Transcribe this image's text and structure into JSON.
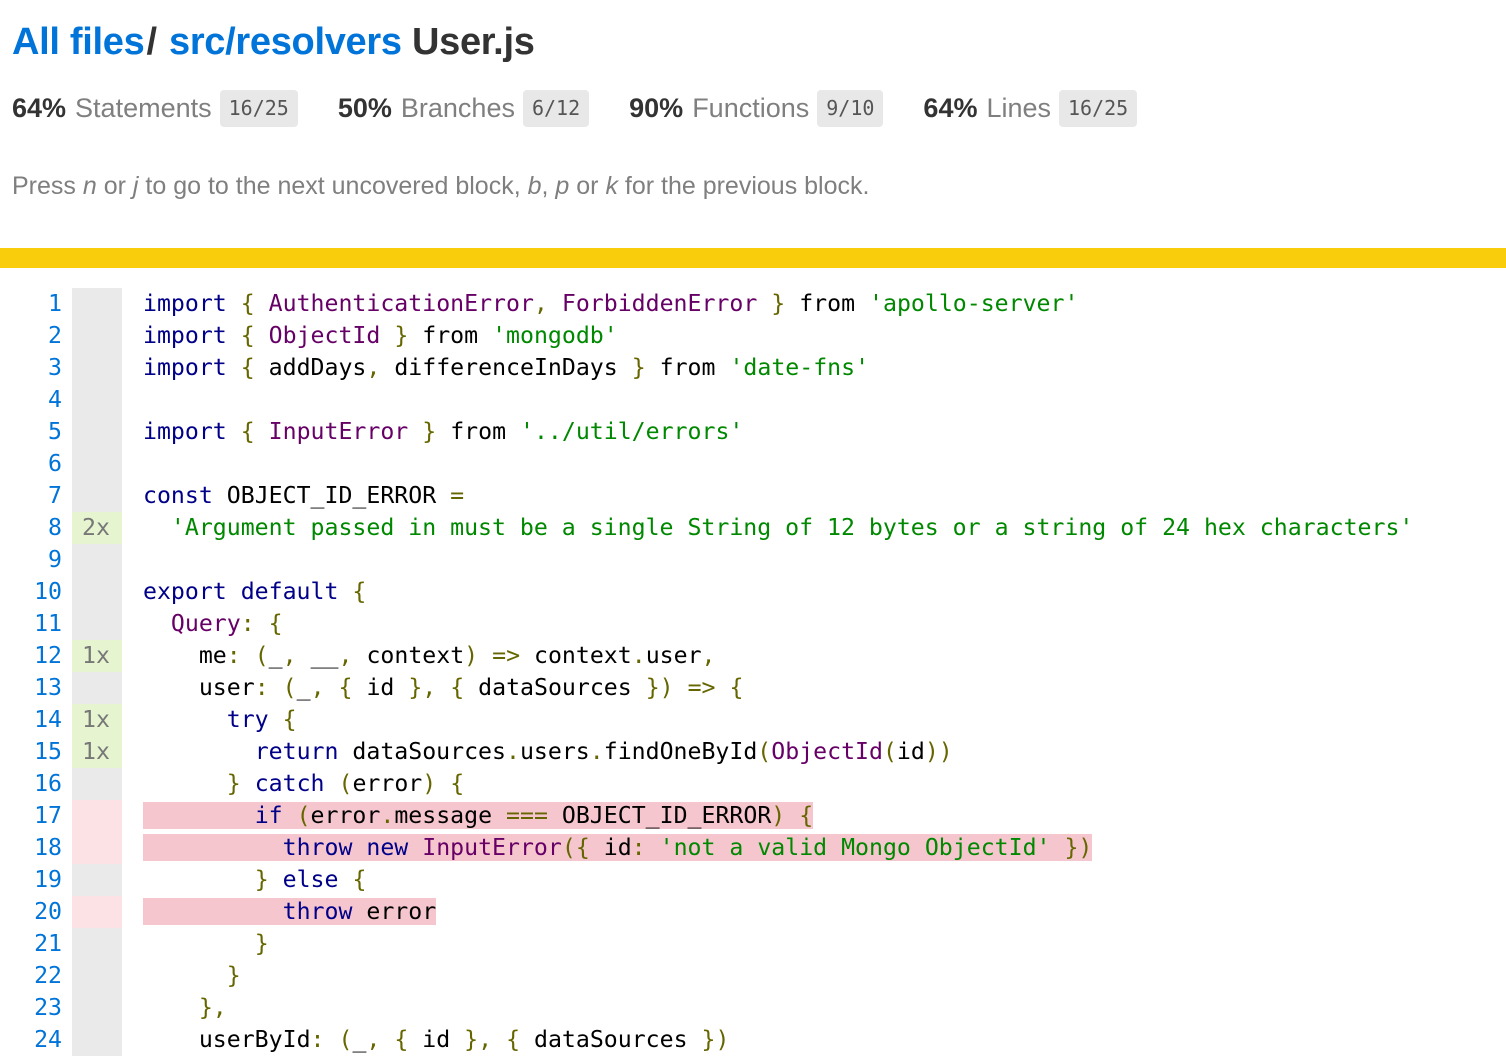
{
  "breadcrumb": {
    "all_files": "All files",
    "separator": "/",
    "folder": "src/resolvers",
    "file": "User.js"
  },
  "stats": [
    {
      "pct": "64%",
      "label": "Statements",
      "fraction": "16/25"
    },
    {
      "pct": "50%",
      "label": "Branches",
      "fraction": "6/12"
    },
    {
      "pct": "90%",
      "label": "Functions",
      "fraction": "9/10"
    },
    {
      "pct": "64%",
      "label": "Lines",
      "fraction": "16/25"
    }
  ],
  "hint": {
    "t1": "Press ",
    "k1": "n",
    "t2": " or ",
    "k2": "j",
    "t3": " to go to the next uncovered block, ",
    "k3": "b",
    "t4": ", ",
    "k4": "p",
    "t5": " or ",
    "k5": "k",
    "t6": " for the previous block."
  },
  "colors": {
    "status_bar": "#f9cd0b",
    "link": "#0074D9",
    "hit": "#e6f5d0",
    "miss": "#f6c6ce"
  },
  "lines": [
    {
      "n": "1",
      "count": "",
      "state": "neutral"
    },
    {
      "n": "2",
      "count": "",
      "state": "neutral"
    },
    {
      "n": "3",
      "count": "",
      "state": "neutral"
    },
    {
      "n": "4",
      "count": "",
      "state": "neutral"
    },
    {
      "n": "5",
      "count": "",
      "state": "neutral"
    },
    {
      "n": "6",
      "count": "",
      "state": "neutral"
    },
    {
      "n": "7",
      "count": "",
      "state": "neutral"
    },
    {
      "n": "8",
      "count": "2x",
      "state": "hit"
    },
    {
      "n": "9",
      "count": "",
      "state": "neutral"
    },
    {
      "n": "10",
      "count": "",
      "state": "neutral"
    },
    {
      "n": "11",
      "count": "",
      "state": "neutral"
    },
    {
      "n": "12",
      "count": "1x",
      "state": "hit"
    },
    {
      "n": "13",
      "count": "",
      "state": "neutral"
    },
    {
      "n": "14",
      "count": "1x",
      "state": "hit"
    },
    {
      "n": "15",
      "count": "1x",
      "state": "hit"
    },
    {
      "n": "16",
      "count": "",
      "state": "neutral"
    },
    {
      "n": "17",
      "count": "",
      "state": "miss"
    },
    {
      "n": "18",
      "count": "",
      "state": "miss"
    },
    {
      "n": "19",
      "count": "",
      "state": "neutral"
    },
    {
      "n": "20",
      "count": "",
      "state": "miss"
    },
    {
      "n": "21",
      "count": "",
      "state": "neutral"
    },
    {
      "n": "22",
      "count": "",
      "state": "neutral"
    },
    {
      "n": "23",
      "count": "",
      "state": "neutral"
    },
    {
      "n": "24",
      "count": "",
      "state": "neutral"
    }
  ],
  "code": {
    "l1": [
      "import",
      "{",
      "AuthenticationError",
      ",",
      "ForbiddenError",
      "}",
      "from",
      "'apollo-server'"
    ],
    "l2": [
      "import",
      "{",
      "ObjectId",
      "}",
      "from",
      "'mongodb'"
    ],
    "l3": [
      "import",
      "{",
      "addDays",
      ",",
      "differenceInDays",
      "}",
      "from",
      "'date-fns'"
    ],
    "l5": [
      "import",
      "{",
      "InputError",
      "}",
      "from",
      "'../util/errors'"
    ],
    "l7": [
      "const",
      "OBJECT_ID_ERROR",
      "="
    ],
    "l8": [
      "'Argument passed in must be a single String of 12 bytes or a string of 24 hex characters'"
    ],
    "l10": [
      "export default",
      "{"
    ],
    "l11": [
      "Query",
      ":",
      "{"
    ],
    "l12": [
      "me",
      ":",
      "(",
      "_",
      ",",
      "__",
      ",",
      "context",
      ")",
      "=>",
      "context",
      ".",
      "user",
      ","
    ],
    "l13": [
      "user",
      ":",
      "(",
      "_",
      ",",
      "{",
      "id",
      "},",
      "{",
      "dataSources",
      "})",
      "=>",
      "{"
    ],
    "l14": [
      "try",
      "{"
    ],
    "l15": [
      "return",
      "dataSources",
      ".",
      "users",
      ".",
      "findOneById",
      "(",
      "ObjectId",
      "(",
      "id",
      "))"
    ],
    "l16": [
      "}",
      "catch",
      "(",
      "error",
      ")",
      "{"
    ],
    "l17": [
      "if",
      "(",
      "error",
      ".",
      "message",
      "===",
      "OBJECT_ID_ERROR",
      ")",
      "{"
    ],
    "l18": [
      "throw",
      "new",
      "InputError",
      "({",
      "id",
      ":",
      "'not a valid Mongo ObjectId'",
      "})"
    ],
    "l19": [
      "}",
      "else",
      "{"
    ],
    "l20": [
      "throw",
      "error"
    ],
    "l21": [
      "}"
    ],
    "l22": [
      "}"
    ],
    "l23": [
      "},"
    ],
    "l24": [
      "userById",
      ":",
      "(",
      "_",
      ",",
      "{",
      "id",
      "},",
      "{",
      "dataSources",
      "})"
    ]
  }
}
